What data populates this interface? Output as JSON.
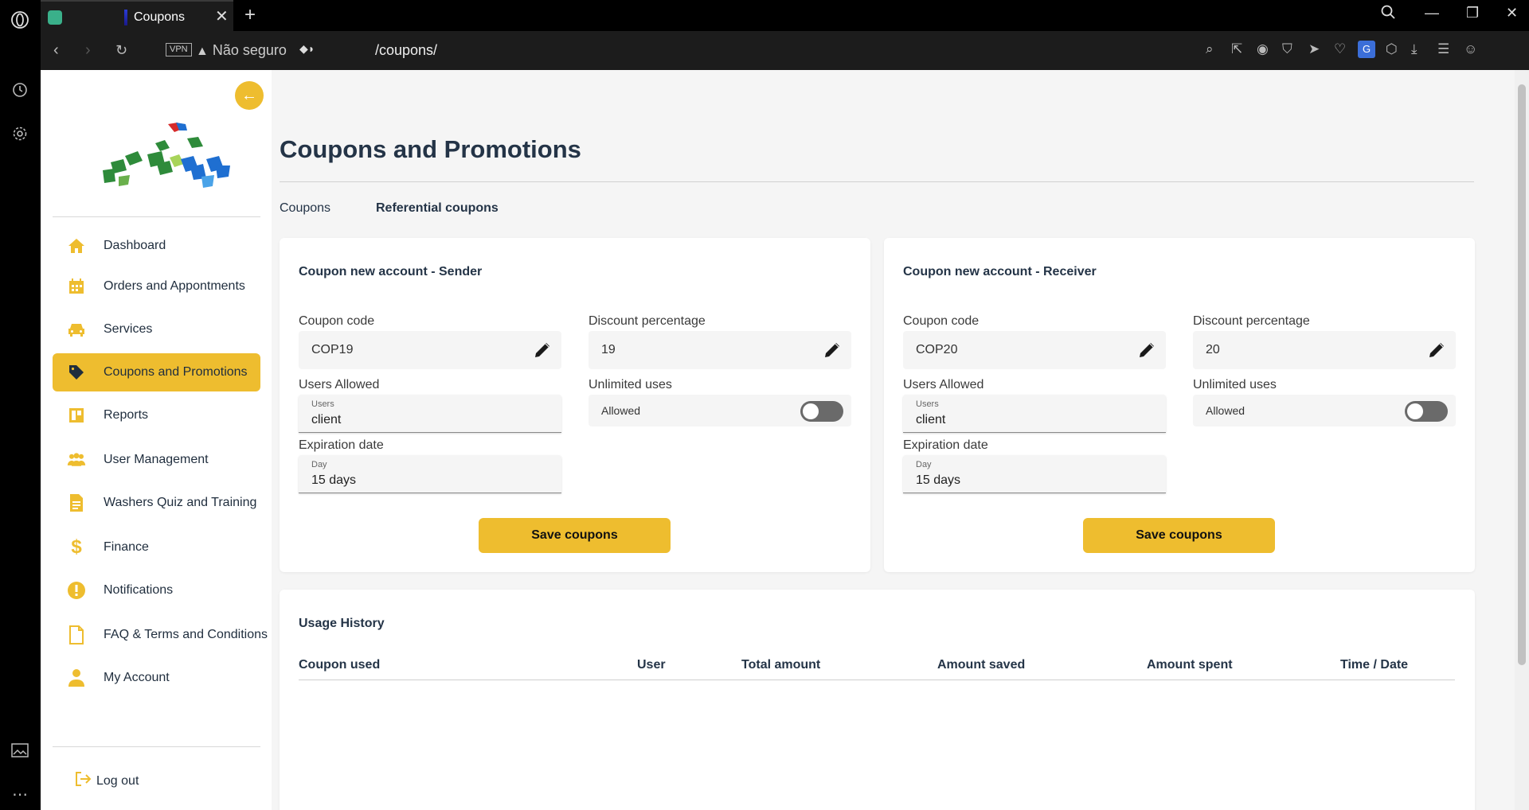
{
  "browser": {
    "tab_title": "Coupons",
    "vpn_label": "VPN",
    "security_text": "Não seguro",
    "url": "/coupons/"
  },
  "sidebar": {
    "items": [
      {
        "label": "Dashboard",
        "icon": "home-icon",
        "active": false
      },
      {
        "label": "Orders and Appontments",
        "icon": "calendar-icon",
        "active": false
      },
      {
        "label": "Services",
        "icon": "car-icon",
        "active": false
      },
      {
        "label": "Coupons and Promotions",
        "icon": "tag-icon",
        "active": true
      },
      {
        "label": "Reports",
        "icon": "report-icon",
        "active": false
      },
      {
        "label": "User Management",
        "icon": "users-icon",
        "active": false
      },
      {
        "label": "Washers Quiz and Training",
        "icon": "document-icon",
        "active": false
      },
      {
        "label": "Finance",
        "icon": "dollar-icon",
        "active": false
      },
      {
        "label": "Notifications",
        "icon": "alert-icon",
        "active": false
      },
      {
        "label": "FAQ & Terms and Conditions",
        "icon": "file-icon",
        "active": false
      },
      {
        "label": "My Account",
        "icon": "person-icon",
        "active": false
      }
    ],
    "logout_label": "Log out"
  },
  "main": {
    "title": "Coupons and Promotions",
    "tabs": [
      {
        "label": "Coupons",
        "selected": false
      },
      {
        "label": "Referential coupons",
        "selected": true
      }
    ],
    "cards": [
      {
        "title": "Coupon new account - Sender",
        "coupon_code_label": "Coupon code",
        "coupon_code": "COP19",
        "discount_label": "Discount percentage",
        "discount": "19",
        "users_allowed_label": "Users Allowed",
        "users_caption": "Users",
        "users_value": "client",
        "unlimited_label": "Unlimited uses",
        "toggle_label": "Allowed",
        "expiration_label": "Expiration date",
        "day_caption": "Day",
        "day_value": "15 days",
        "save_label": "Save coupons"
      },
      {
        "title": "Coupon new account - Receiver",
        "coupon_code_label": "Coupon code",
        "coupon_code": "COP20",
        "discount_label": "Discount percentage",
        "discount": "20",
        "users_allowed_label": "Users Allowed",
        "users_caption": "Users",
        "users_value": "client",
        "unlimited_label": "Unlimited uses",
        "toggle_label": "Allowed",
        "expiration_label": "Expiration date",
        "day_caption": "Day",
        "day_value": "15 days",
        "save_label": "Save coupons"
      }
    ],
    "history": {
      "title": "Usage History",
      "columns": [
        "Coupon used",
        "User",
        "Total amount",
        "Amount saved",
        "Amount spent",
        "Time / Date"
      ]
    }
  },
  "colors": {
    "accent": "#eebd2f",
    "heading": "#243447"
  }
}
